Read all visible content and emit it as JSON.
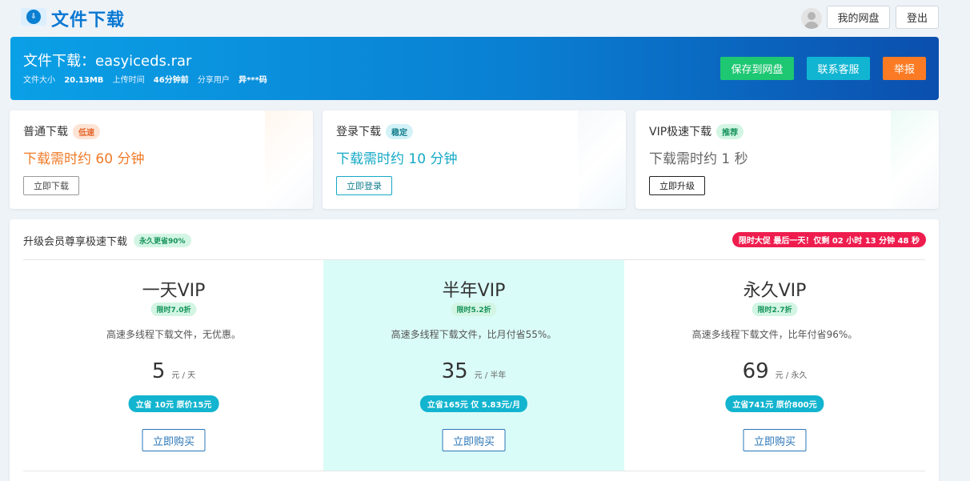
{
  "header": {
    "logo_icon": "logo-icon",
    "title": "文件下载",
    "avatar_icon": "user-avatar-icon",
    "my_pan_label": "我的网盘",
    "logout_label": "登出"
  },
  "banner": {
    "title": "文件下载：easyiceds.rar",
    "size_label": "文件大小",
    "size_value": "20.13MB",
    "upload_label": "上传时间",
    "upload_value": "46分钟前",
    "share_label": "分享用户",
    "share_value": "异***码",
    "save_label": "保存到网盘",
    "contact_label": "联系客服",
    "report_label": "举报",
    "colors": {
      "save": "#1ec772",
      "contact": "#11b5d2",
      "report": "#fa7b24"
    }
  },
  "download_options": [
    {
      "name": "普通下载",
      "badge": "低速",
      "time": "下载需时约 60 分钟",
      "button": "立即下载"
    },
    {
      "name": "登录下载",
      "badge": "稳定",
      "time": "下载需时约 10 分钟",
      "button": "立即登录"
    },
    {
      "name": "VIP极速下载",
      "badge": "推荐",
      "time": "下载需时约 1 秒",
      "button": "立即升级"
    }
  ],
  "upgrade": {
    "title": "升级会员尊享极速下载",
    "title_badge": "永久更省90%",
    "promo": "限时大促 最后一天！仅剩 02 小时 13 分钟 48 秒",
    "plans": [
      {
        "name": "一天VIP",
        "tag": "限时7.0折",
        "desc": "高速多线程下载文件，无优惠。",
        "price": "5",
        "unit": "元 / 天",
        "save": "立省 10元 原价15元",
        "button": "立即购买"
      },
      {
        "name": "半年VIP",
        "tag": "限时5.2折",
        "desc": "高速多线程下载文件，比月付省55%。",
        "price": "35",
        "unit": "元 / 半年",
        "save": "立省165元 仅 5.83元/月",
        "button": "立即购买"
      },
      {
        "name": "永久VIP",
        "tag": "限时2.7折",
        "desc": "高速多线程下载文件，比年付省96%。",
        "price": "69",
        "unit": "元 / 永久",
        "save": "立省741元 原价800元",
        "button": "立即购买"
      }
    ]
  }
}
